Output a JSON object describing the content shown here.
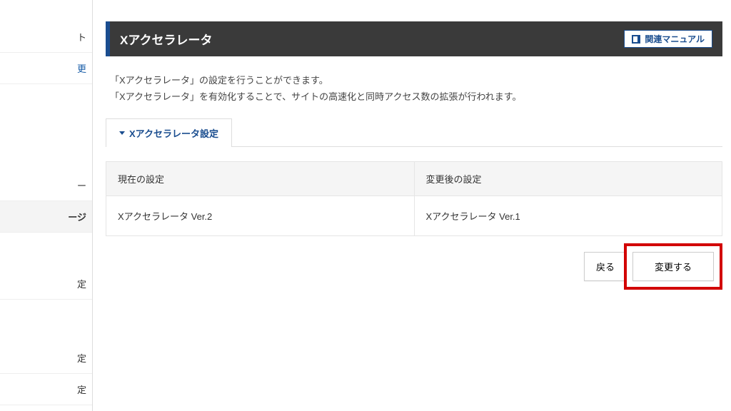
{
  "sidebar": {
    "items": [
      {
        "label": "ト"
      },
      {
        "label": "更"
      },
      {
        "label": "ー"
      },
      {
        "label": "ージ"
      },
      {
        "label": "定"
      },
      {
        "label": "定"
      },
      {
        "label": "定"
      }
    ]
  },
  "header": {
    "title": "Xアクセラレータ",
    "manual_label": "関連マニュアル"
  },
  "description": {
    "line1": "「Xアクセラレータ」の設定を行うことができます。",
    "line2": "「Xアクセラレータ」を有効化することで、サイトの高速化と同時アクセス数の拡張が行われます。"
  },
  "tab": {
    "label": "Xアクセラレータ設定"
  },
  "table": {
    "header_current": "現在の設定",
    "header_after": "変更後の設定",
    "value_current": "Xアクセラレータ Ver.2",
    "value_after": "Xアクセラレータ Ver.1"
  },
  "buttons": {
    "back": "戻る",
    "change": "変更する"
  }
}
